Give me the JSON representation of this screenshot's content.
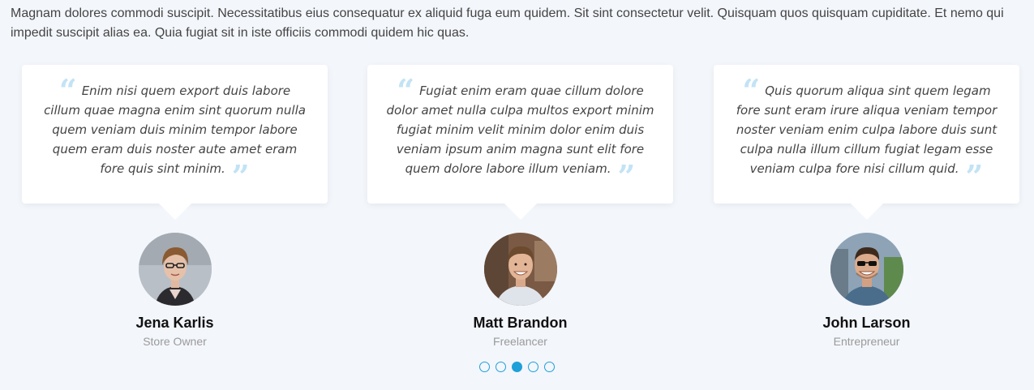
{
  "intro": {
    "text": "Magnam dolores commodi suscipit. Necessitatibus eius consequatur ex aliquid fuga eum quidem. Sit sint consectetur velit. Quisquam quos quisquam cupiditate. Et nemo qui impedit suscipit alias ea. Quia fugiat sit in iste officiis commodi quidem hic quas."
  },
  "testimonials": [
    {
      "quote": "Enim nisi quem export duis labore cillum quae magna enim sint quorum nulla quem veniam duis minim tempor labore quem eram duis noster aute amet eram fore quis sint minim.",
      "name": "Jena Karlis",
      "role": "Store Owner",
      "avatar_icon": "woman-with-glasses-photo"
    },
    {
      "quote": "Fugiat enim eram quae cillum dolore dolor amet nulla culpa multos export minim fugiat minim velit minim dolor enim duis veniam ipsum anim magna sunt elit fore quem dolore labore illum veniam.",
      "name": "Matt Brandon",
      "role": "Freelancer",
      "avatar_icon": "smiling-man-photo"
    },
    {
      "quote": "Quis quorum aliqua sint quem legam fore sunt eram irure aliqua veniam tempor noster veniam enim culpa labore duis sunt culpa nulla illum cillum fugiat legam esse veniam culpa fore nisi cillum quid.",
      "name": "John Larson",
      "role": "Entrepreneur",
      "avatar_icon": "man-with-sunglasses-photo"
    }
  ],
  "quote_icons": {
    "open": "“",
    "close": "”"
  },
  "pagination": {
    "count": 5,
    "active_index": 2
  },
  "colors": {
    "accent": "#1ea0d8",
    "quote_icon": "#c3e3f5",
    "background": "#f3f6fb"
  }
}
